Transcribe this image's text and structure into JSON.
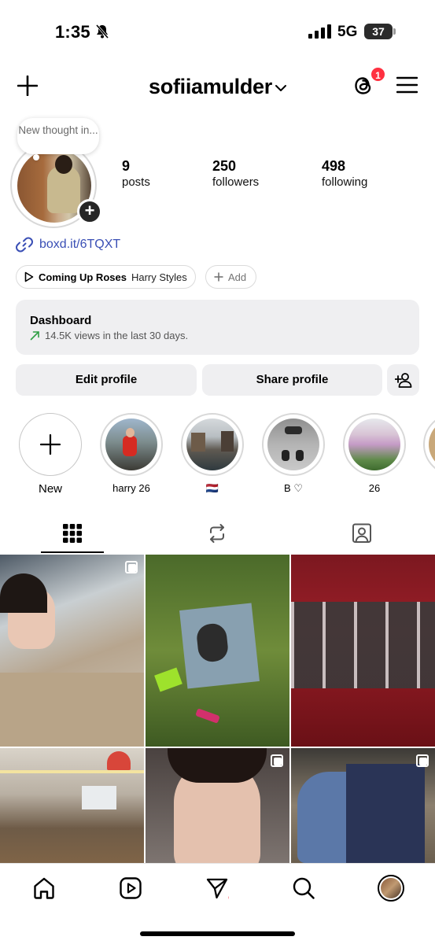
{
  "status_bar": {
    "time": "1:35",
    "network": "5G",
    "battery": "37"
  },
  "header": {
    "username": "sofiiamulder",
    "threads_badge": "1",
    "icons": {
      "create": "plus-icon",
      "threads": "threads-icon",
      "menu": "hamburger-menu-icon",
      "switcher": "chevron-down-icon"
    }
  },
  "profile": {
    "note": "New thought in...",
    "stats": [
      {
        "value": "9",
        "label": "posts"
      },
      {
        "value": "250",
        "label": "followers"
      },
      {
        "value": "498",
        "label": "following"
      }
    ],
    "link": "boxd.it/6TQXT",
    "music": {
      "song": "Coming Up Roses",
      "artist": "Harry Styles"
    },
    "add_label": "Add"
  },
  "dashboard": {
    "title": "Dashboard",
    "subtitle": "14.5K views in the last 30 days."
  },
  "buttons": {
    "edit": "Edit profile",
    "share": "Share profile"
  },
  "highlights": [
    {
      "label": "New"
    },
    {
      "label": "harry 26"
    },
    {
      "label": "🇳🇱"
    },
    {
      "label": "B ♡"
    },
    {
      "label": "26"
    }
  ],
  "tabs": [
    "grid-icon",
    "reposts-icon",
    "tagged-icon"
  ],
  "nav": [
    "home-icon",
    "reels-icon",
    "messages-icon",
    "search-icon",
    "profile-avatar"
  ],
  "colors": {
    "badge": "#ff3040",
    "link": "#3a4fb5",
    "surface": "#efeff1"
  }
}
